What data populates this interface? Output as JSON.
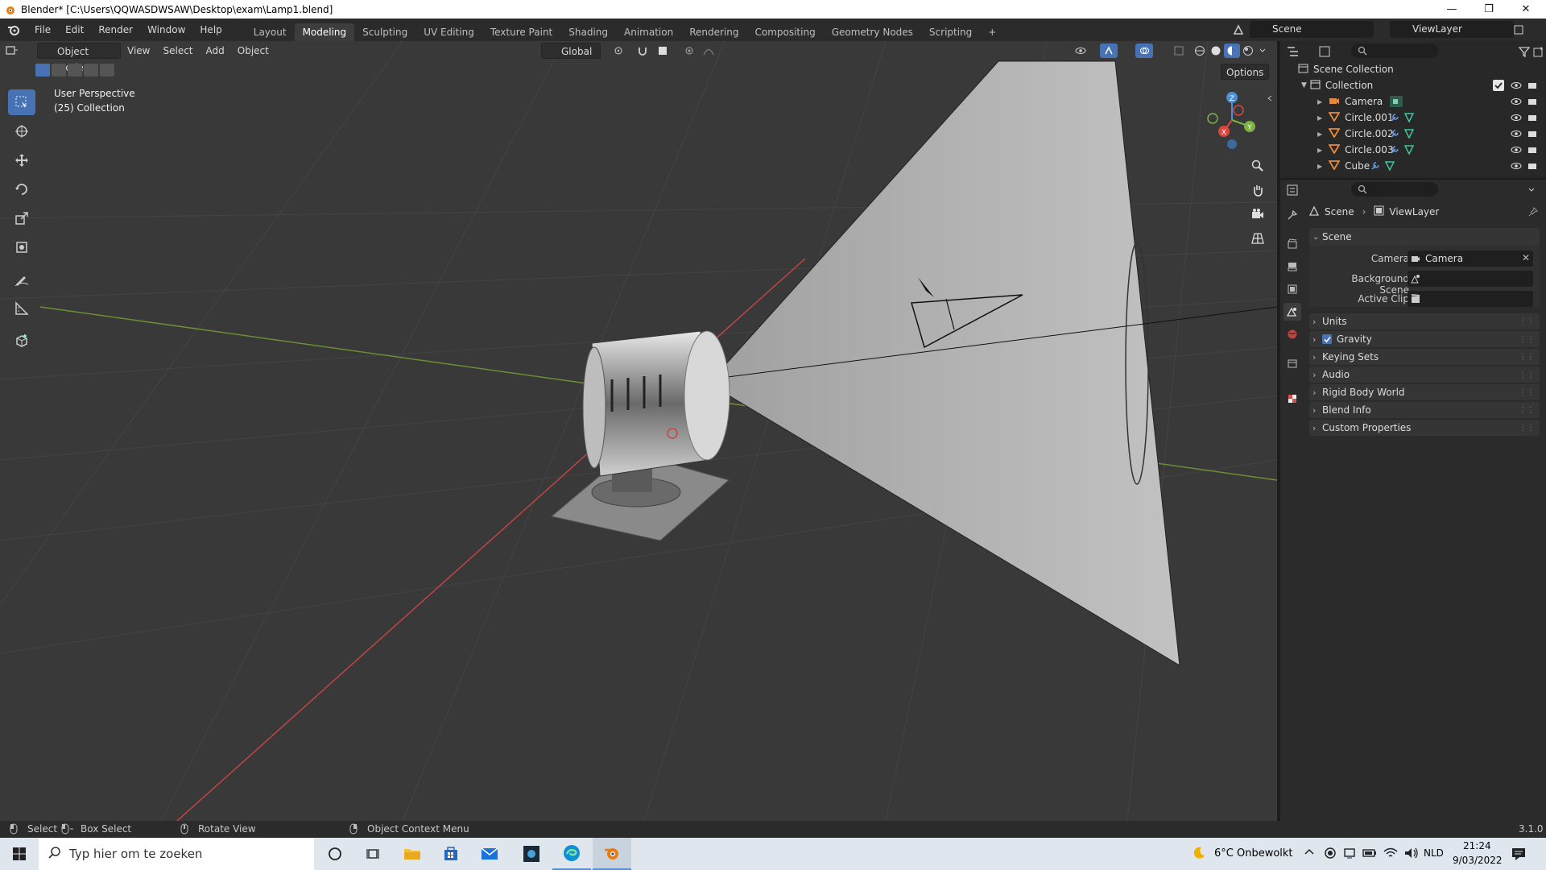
{
  "window": {
    "title": "Blender* [C:\\Users\\QQWASDWSAW\\Desktop\\exam\\Lamp1.blend]",
    "minimize": "—",
    "maximize": "❐",
    "close": "✕"
  },
  "menu": [
    "File",
    "Edit",
    "Render",
    "Window",
    "Help"
  ],
  "workspaces": [
    {
      "label": "Layout",
      "active": false
    },
    {
      "label": "Modeling",
      "active": true
    },
    {
      "label": "Sculpting",
      "active": false
    },
    {
      "label": "UV Editing",
      "active": false
    },
    {
      "label": "Texture Paint",
      "active": false
    },
    {
      "label": "Shading",
      "active": false
    },
    {
      "label": "Animation",
      "active": false
    },
    {
      "label": "Rendering",
      "active": false
    },
    {
      "label": "Compositing",
      "active": false
    },
    {
      "label": "Geometry Nodes",
      "active": false
    },
    {
      "label": "Scripting",
      "active": false
    }
  ],
  "add_workspace": "+",
  "scene_selector": {
    "value": "Scene"
  },
  "viewlayer_selector": {
    "value": "ViewLayer"
  },
  "viewport": {
    "mode": "Object Mode",
    "menus": [
      "View",
      "Select",
      "Add",
      "Object"
    ],
    "transform_orientation": "Global",
    "options": "Options",
    "perspective_label": "User Perspective",
    "collection_label": "(25) Collection",
    "gizmo": {
      "x": "X",
      "y": "Y",
      "z": "Z"
    }
  },
  "outliner": {
    "root": "Scene Collection",
    "collection": "Collection",
    "items": [
      {
        "name": "Camera",
        "icon": "camera-object-icon"
      },
      {
        "name": "Circle.001",
        "icon": "mesh-object-icon"
      },
      {
        "name": "Circle.002",
        "icon": "mesh-object-icon"
      },
      {
        "name": "Circle.003",
        "icon": "mesh-object-icon"
      },
      {
        "name": "Cube",
        "icon": "mesh-object-icon"
      }
    ]
  },
  "properties": {
    "breadcrumb": [
      "Scene",
      "ViewLayer"
    ],
    "panel_title": "Scene",
    "fields": [
      {
        "label": "Camera",
        "value": "Camera"
      },
      {
        "label": "Background Scene",
        "value": ""
      },
      {
        "label": "Active Clip",
        "value": ""
      }
    ],
    "subpanels": [
      "Units",
      "Gravity",
      "Keying Sets",
      "Audio",
      "Rigid Body World",
      "Blend Info",
      "Custom Properties"
    ]
  },
  "statusbar": {
    "select": "Select",
    "box_select": "Box Select",
    "rotate_view": "Rotate View",
    "context_menu": "Object Context Menu",
    "version": "3.1.0"
  },
  "taskbar": {
    "search_placeholder": "Typ hier om te zoeken",
    "weather": "6°C  Onbewolkt",
    "language": "NLD",
    "time": "21:24",
    "date": "9/03/2022"
  },
  "colors": {
    "accent": "#4772b3",
    "x_axis": "#e0443e",
    "y_axis": "#7cb342",
    "z_axis": "#4a90d9",
    "object_orange": "#e8893a"
  }
}
